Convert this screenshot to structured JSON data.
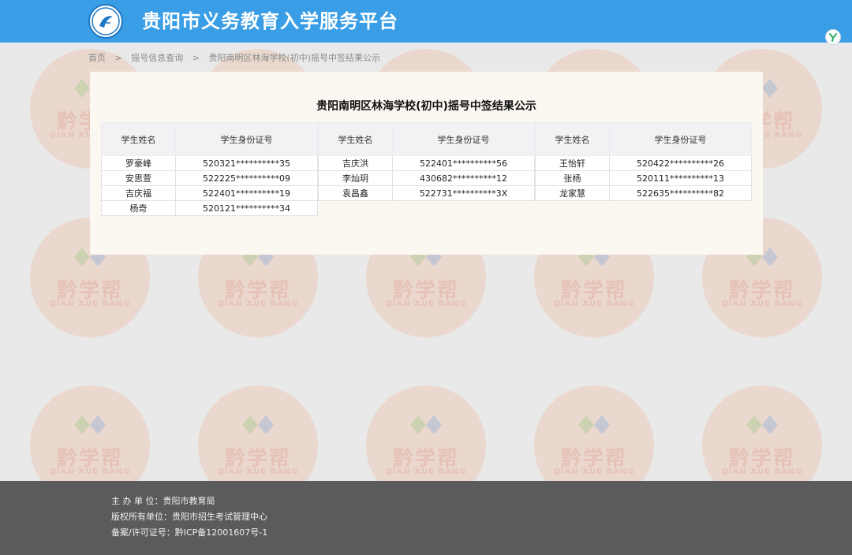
{
  "header": {
    "site_title": "贵阳市义务教育入学服务平台"
  },
  "breadcrumb": {
    "items": [
      "首页",
      "摇号信息查询",
      "贵阳南明区林海学校(初中)摇号中签结果公示"
    ],
    "separator": ">"
  },
  "card": {
    "title": "贵阳南明区林海学校(初中)摇号中签结果公示"
  },
  "table_headers": {
    "name": "学生姓名",
    "id": "学生身份证号"
  },
  "results": [
    [
      {
        "name": "罗豪峰",
        "id": "520321**********35"
      },
      {
        "name": "安思萱",
        "id": "522225**********09"
      },
      {
        "name": "吉庆福",
        "id": "522401**********19"
      },
      {
        "name": "杨奇",
        "id": "520121**********34"
      }
    ],
    [
      {
        "name": "吉庆洪",
        "id": "522401**********56"
      },
      {
        "name": "李灿玥",
        "id": "430682**********12"
      },
      {
        "name": "袁昌鑫",
        "id": "522731**********3X"
      }
    ],
    [
      {
        "name": "王怡轩",
        "id": "520422**********26"
      },
      {
        "name": "张杨",
        "id": "520111**********13"
      },
      {
        "name": "龙家慧",
        "id": "522635**********82"
      }
    ]
  ],
  "watermark": {
    "text_cn": "黔学帮",
    "text_en": "QIAN XUE BANG"
  },
  "footer": {
    "lines": [
      "主  办  单  位：贵阳市教育局",
      "版权所有单位：贵阳市招生考试管理中心",
      "备案/许可证号：黔ICP备12001607号-1"
    ]
  },
  "colors": {
    "header_bg": "#3a9ee6",
    "page_bg": "#e9e9e9",
    "footer_bg": "#5b5b5b"
  }
}
